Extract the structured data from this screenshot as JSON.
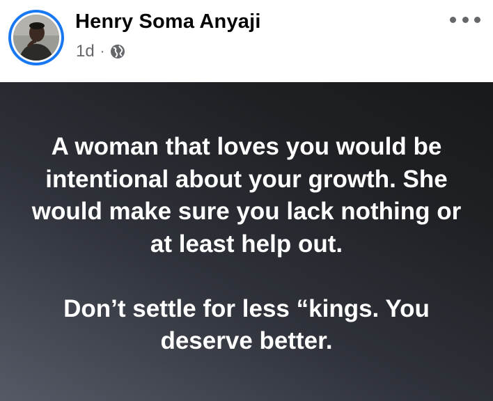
{
  "post": {
    "author_name": "Henry Soma Anyaji",
    "timestamp": "1d",
    "separator": "·",
    "audience_icon": "globe-icon",
    "menu_icon": "more-horizontal-icon",
    "paragraphs": [
      "A woman that loves you would be intentional about your growth. She would make sure you lack nothing or at least help out.",
      "Don’t settle for less “kings. You deserve better."
    ]
  },
  "colors": {
    "story_ring": "#1877f2",
    "name_text": "#050505",
    "meta_text": "#65676b",
    "card_background_dark": "#18191c",
    "card_background_light": "#555a66",
    "card_text": "#ffffff"
  }
}
